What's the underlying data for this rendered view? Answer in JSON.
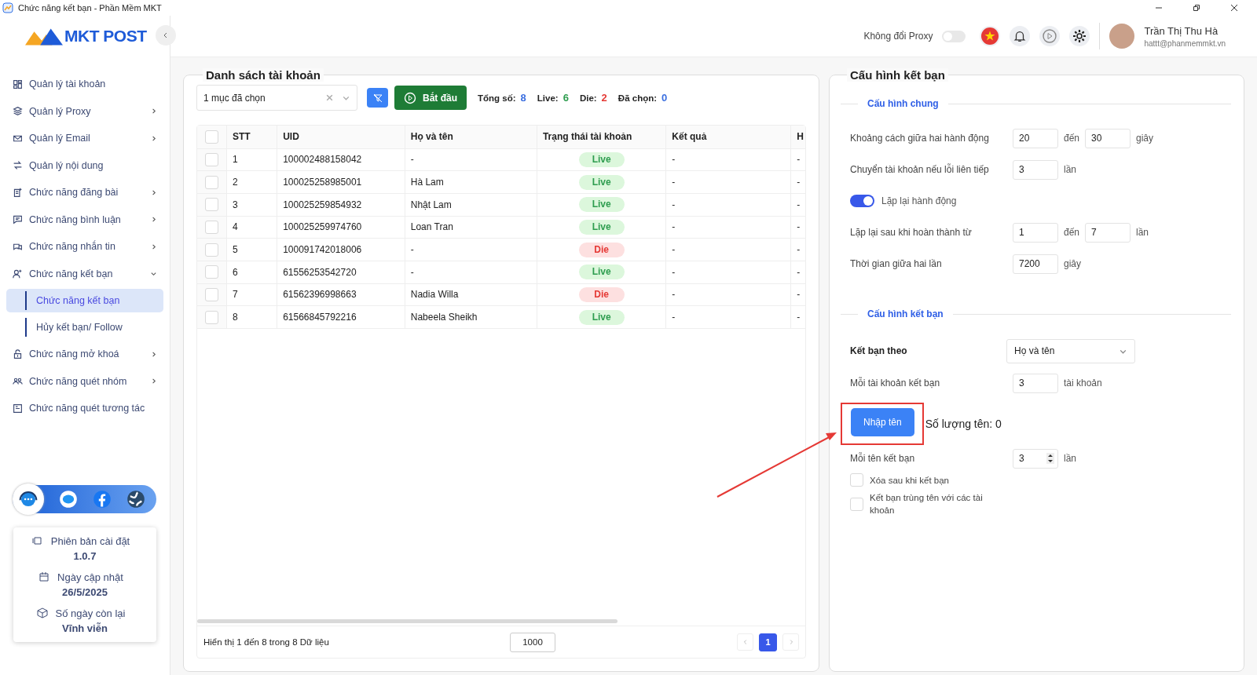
{
  "window": {
    "title": "Chức năng kết bạn - Phần Mềm MKT"
  },
  "sidebar": {
    "logo": "MKT POST",
    "items": [
      {
        "label": "Quản lý tài khoản",
        "expandable": false
      },
      {
        "label": "Quản lý Proxy",
        "expandable": true,
        "expanded": false
      },
      {
        "label": "Quản lý Email",
        "expandable": true,
        "expanded": false
      },
      {
        "label": "Quản lý nội dung",
        "expandable": false
      },
      {
        "label": "Chức năng đăng bài",
        "expandable": true,
        "expanded": false
      },
      {
        "label": "Chức năng bình luận",
        "expandable": true,
        "expanded": false
      },
      {
        "label": "Chức năng nhắn tin",
        "expandable": true,
        "expanded": false
      },
      {
        "label": "Chức năng kết bạn",
        "expandable": true,
        "expanded": true,
        "children": [
          {
            "label": "Chức năng kết bạn",
            "selected": true
          },
          {
            "label": "Hủy kết bạn/ Follow",
            "selected": false
          }
        ]
      },
      {
        "label": "Chức năng mở khoá",
        "expandable": true,
        "expanded": false
      },
      {
        "label": "Chức năng quét nhóm",
        "expandable": true,
        "expanded": false
      },
      {
        "label": "Chức năng quét tương tác",
        "expandable": false
      }
    ],
    "info": [
      {
        "label": "Phiên bản cài đặt",
        "value": "1.0.7"
      },
      {
        "label": "Ngày cập nhật",
        "value": "26/5/2025"
      },
      {
        "label": "Số ngày còn lại",
        "value": "Vĩnh viễn"
      }
    ]
  },
  "header": {
    "proxy_toggle": {
      "label": "Không đổi Proxy",
      "on": false
    },
    "user": {
      "name": "Trần Thị Thu Hà",
      "email": "hattt@phanmemmkt.vn"
    }
  },
  "accounts": {
    "title": "Danh sách tài khoản",
    "select": {
      "value": "1 mục đã chọn"
    },
    "start_button": "Bắt đầu",
    "stats": [
      {
        "label": "Tổng số:",
        "value": "8",
        "color": "#3b6fe0"
      },
      {
        "label": "Live:",
        "value": "6",
        "color": "#2e9d4f"
      },
      {
        "label": "Die:",
        "value": "2",
        "color": "#e53935"
      },
      {
        "label": "Đã chọn:",
        "value": "0",
        "color": "#3b6fe0"
      }
    ],
    "table": {
      "header_checked": false,
      "columns": [
        "STT",
        "UID",
        "Họ và tên",
        "Trạng thái tài khoản",
        "Kết quả",
        "H"
      ],
      "rows": [
        {
          "selected": false,
          "stt": "1",
          "uid": "100002488158042",
          "name": "-",
          "status": "Live",
          "kind": "live",
          "result": "-",
          "column_6": "-"
        },
        {
          "selected": false,
          "stt": "2",
          "uid": "100025258985001",
          "name": "Hà Lam",
          "status": "Live",
          "kind": "live",
          "result": "-",
          "column_6": "-"
        },
        {
          "selected": false,
          "stt": "3",
          "uid": "100025259854932",
          "name": "Nhật Lam",
          "status": "Live",
          "kind": "live",
          "result": "-",
          "column_6": "-"
        },
        {
          "selected": false,
          "stt": "4",
          "uid": "100025259974760",
          "name": "Loan Tran",
          "status": "Live",
          "kind": "live",
          "result": "-",
          "column_6": "-"
        },
        {
          "selected": false,
          "stt": "5",
          "uid": "100091742018006",
          "name": "-",
          "status": "Die",
          "kind": "die",
          "result": "-",
          "column_6": "-"
        },
        {
          "selected": false,
          "stt": "6",
          "uid": "61556253542720",
          "name": "-",
          "status": "Live",
          "kind": "live",
          "result": "-",
          "column_6": "-"
        },
        {
          "selected": false,
          "stt": "7",
          "uid": "61562396998663",
          "name": "Nadia Willa",
          "status": "Die",
          "kind": "die",
          "result": "-",
          "column_6": "-"
        },
        {
          "selected": false,
          "stt": "8",
          "uid": "61566845792216",
          "name": "Nabeela Sheikh",
          "status": "Live",
          "kind": "live",
          "result": "-",
          "column_6": "-"
        }
      ]
    },
    "footer": {
      "summary": "Hiển thị 1 đến 8 trong 8 Dữ liệu",
      "page_size": "1000",
      "pages": [
        {
          "label": "1",
          "selected": true
        }
      ]
    }
  },
  "config": {
    "title": "Cấu hình kết bạn",
    "general": {
      "title": "Cấu hình chung",
      "rows": [
        {
          "kind": "range",
          "label": "Khoảng cách giữa hai hành động",
          "from": "20",
          "joiner": "đến",
          "to": "30",
          "unit": "giây"
        },
        {
          "kind": "single",
          "label": "Chuyển tài khoản nếu lỗi liên tiếp",
          "value": "3",
          "unit": "lần"
        },
        {
          "kind": "toggle",
          "label": "Lặp lại hành động",
          "on": true
        },
        {
          "kind": "range",
          "label": "Lặp lại sau khi hoàn thành từ",
          "from": "1",
          "joiner": "đến",
          "to": "7",
          "unit": "lần"
        },
        {
          "kind": "single",
          "label": "Thời gian giữa hai lần",
          "value": "7200",
          "unit": "giây"
        }
      ]
    },
    "friend": {
      "title": "Cấu hình kết bạn",
      "by": {
        "label": "Kết bạn theo",
        "value": "Họ và tên"
      },
      "per_account": {
        "label": "Mỗi tài khoản kết bạn",
        "value": "3",
        "unit": "tài khoản"
      },
      "import_button": "Nhập tên",
      "name_count": "Số lượng tên: 0",
      "per_name": {
        "label": "Mỗi tên kết bạn",
        "value": "3",
        "unit": "lần"
      },
      "checkboxes": [
        {
          "label": "Xóa sau khi kết bạn",
          "checked": false
        },
        {
          "label": "Kết bạn trùng tên với các tài khoản",
          "checked": false
        }
      ]
    }
  }
}
